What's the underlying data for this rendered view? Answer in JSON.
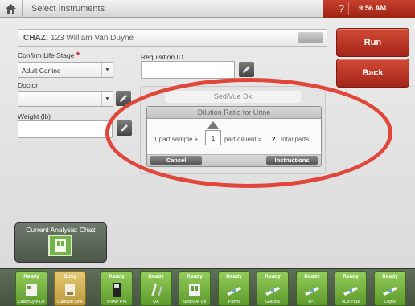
{
  "topbar": {
    "title": "Select Instruments",
    "help": "?",
    "time": "9:56 AM"
  },
  "patient": {
    "label": "CHAZ:",
    "name": "123 William Van Duyne"
  },
  "actions": {
    "run": "Run",
    "back": "Back"
  },
  "form": {
    "life_stage_label": "Confirm Life Stage",
    "required_mark": "*",
    "life_stage_value": "Adult Canine",
    "requisition_label": "Requisition ID",
    "requisition_value": "",
    "doctor_label": "Doctor",
    "doctor_value": "",
    "weight_label": "Weight (lb)",
    "weight_value": ""
  },
  "sedivue": {
    "title": "SediVue Dx",
    "dilution": {
      "title": "Dilution Ratio for Urine",
      "prefix": "1 part sample +",
      "diluent_value": "1",
      "middle": "part diluent =",
      "total": "2",
      "suffix": "total parts",
      "cancel": "Cancel",
      "instructions": "Instructions"
    }
  },
  "current_analysis": {
    "title": "Current Analysis: Chaz"
  },
  "instruments": [
    {
      "status": "Ready",
      "name": "LaserCyte Dx",
      "icon": "lasercyte-icon"
    },
    {
      "status": "Busy",
      "name": "Catalyst One",
      "icon": "catalyst-icon"
    },
    {
      "status": "Ready",
      "name": "SNAP Pro",
      "icon": "snap-pro-icon"
    },
    {
      "status": "Ready",
      "name": "UA",
      "icon": "urinalysis-icon"
    },
    {
      "status": "Ready",
      "name": "SediVue Dx",
      "icon": "sedivue-icon"
    },
    {
      "status": "Ready",
      "name": "Parvo",
      "icon": "snap-test-icon"
    },
    {
      "status": "Ready",
      "name": "Giardia",
      "icon": "snap-test-icon"
    },
    {
      "status": "Ready",
      "name": "cPL",
      "icon": "snap-test-icon"
    },
    {
      "status": "Ready",
      "name": "4Dx Plus",
      "icon": "snap-test-icon"
    },
    {
      "status": "Ready",
      "name": "Lepto",
      "icon": "snap-test-icon"
    }
  ],
  "colors": {
    "accent_red": "#b3301f",
    "ready_green": "#7cb84a",
    "busy_gold": "#d4b45a",
    "annotation_red": "#e0473a"
  }
}
